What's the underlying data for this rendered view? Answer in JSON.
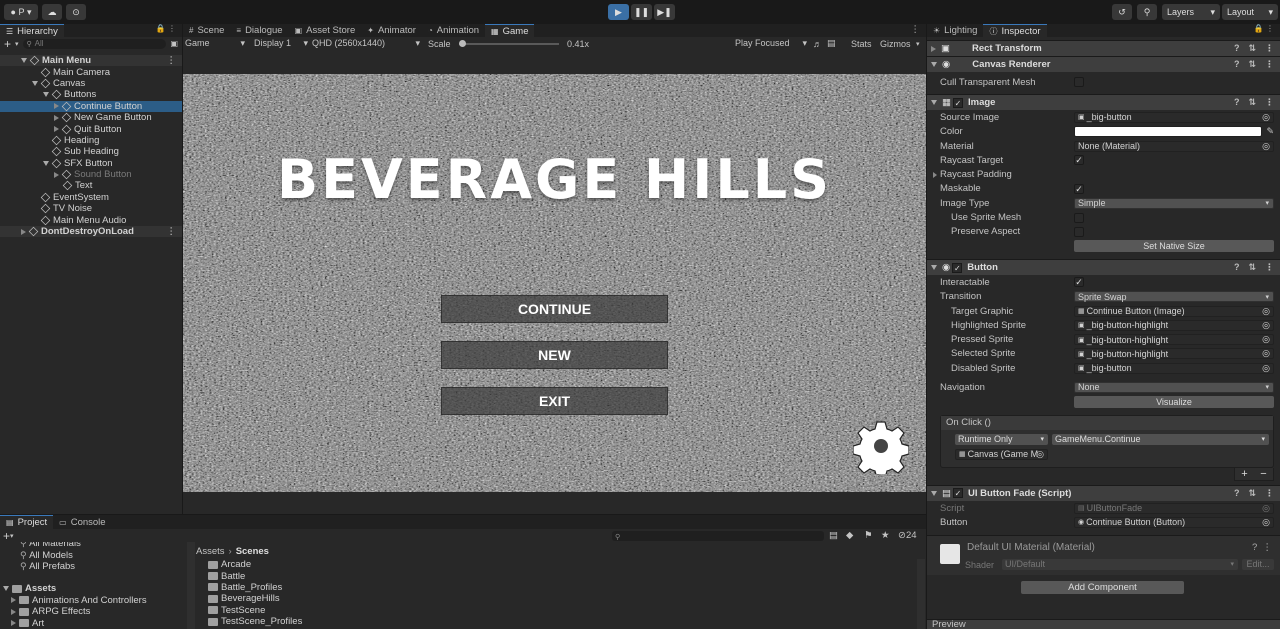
{
  "toolbar": {
    "account": "P",
    "layers": "Layers",
    "layout": "Layout"
  },
  "hierarchy": {
    "tab": "Hierarchy",
    "search_placeholder": "All",
    "items": [
      {
        "label": "Main Menu",
        "depth": 0,
        "kind": "scene",
        "expanded": true
      },
      {
        "label": "Main Camera",
        "depth": 1
      },
      {
        "label": "Canvas",
        "depth": 1,
        "expanded": true
      },
      {
        "label": "Buttons",
        "depth": 2,
        "expanded": true
      },
      {
        "label": "Continue Button",
        "depth": 3,
        "selected": true,
        "collapsed": true
      },
      {
        "label": "New Game Button",
        "depth": 3,
        "collapsed": true
      },
      {
        "label": "Quit Button",
        "depth": 3,
        "collapsed": true
      },
      {
        "label": "Heading",
        "depth": 2
      },
      {
        "label": "Sub Heading",
        "depth": 2
      },
      {
        "label": "SFX Button",
        "depth": 2,
        "expanded": true
      },
      {
        "label": "Sound Button",
        "depth": 3,
        "dim": true,
        "collapsed": true
      },
      {
        "label": "Text",
        "depth": 3
      },
      {
        "label": "EventSystem",
        "depth": 1
      },
      {
        "label": "TV Noise",
        "depth": 1
      },
      {
        "label": "Main Menu Audio",
        "depth": 1
      },
      {
        "label": "DontDestroyOnLoad",
        "depth": 0,
        "kind": "scene",
        "collapsed": true
      }
    ]
  },
  "center_tabs": [
    "Scene",
    "Dialogue",
    "Asset Store",
    "Animator",
    "Animation",
    "Game"
  ],
  "game_bar": {
    "mode": "Game",
    "display": "Display 1",
    "resolution": "QHD (2560x1440)",
    "scale_label": "Scale",
    "scale_value": "0.41x",
    "play_focused": "Play Focused",
    "stats": "Stats",
    "gizmos": "Gizmos"
  },
  "game": {
    "title": "BEVERAGE HILLS",
    "buttons": [
      "CONTINUE",
      "NEW",
      "EXIT"
    ]
  },
  "project": {
    "tabs": [
      "Project",
      "Console"
    ],
    "favorites": [
      "All Materials",
      "All Models",
      "All Prefabs"
    ],
    "assets_root": "Assets",
    "asset_folders": [
      "Animations And Controllers",
      "ARPG Effects",
      "Art"
    ],
    "breadcrumb": [
      "Assets",
      "Scenes"
    ],
    "scene_folders": [
      "Arcade",
      "Battle",
      "Battle_Profiles",
      "BeverageHills",
      "TestScene",
      "TestScene_Profiles"
    ],
    "count": "24"
  },
  "inspector": {
    "tabs": [
      "Lighting",
      "Inspector"
    ],
    "rect_transform": "Rect Transform",
    "canvas_renderer": {
      "title": "Canvas Renderer",
      "cull_label": "Cull Transparent Mesh"
    },
    "image": {
      "title": "Image",
      "source_image_label": "Source Image",
      "source_image": "_big-button",
      "color_label": "Color",
      "color": "#ffffff",
      "material_label": "Material",
      "material": "None (Material)",
      "raycast_target_label": "Raycast Target",
      "raycast_padding_label": "Raycast Padding",
      "maskable_label": "Maskable",
      "image_type_label": "Image Type",
      "image_type": "Simple",
      "use_sprite_mesh_label": "Use Sprite Mesh",
      "preserve_aspect_label": "Preserve Aspect",
      "set_native_size": "Set Native Size"
    },
    "button": {
      "title": "Button",
      "interactable_label": "Interactable",
      "transition_label": "Transition",
      "transition": "Sprite Swap",
      "target_graphic_label": "Target Graphic",
      "target_graphic": "Continue Button (Image)",
      "highlighted_label": "Highlighted Sprite",
      "highlighted": "_big-button-highlight",
      "pressed_label": "Pressed Sprite",
      "pressed": "_big-button-highlight",
      "selected_label": "Selected Sprite",
      "selected": "_big-button-highlight",
      "disabled_label": "Disabled Sprite",
      "disabled": "_big-button",
      "navigation_label": "Navigation",
      "navigation": "None",
      "visualize": "Visualize",
      "onclick_label": "On Click ()",
      "runtime": "Runtime Only",
      "function": "GameMenu.Continue",
      "target_obj": "Canvas (Game M"
    },
    "fade": {
      "title": "UI Button Fade (Script)",
      "script_label": "Script",
      "script": "UIButtonFade",
      "button_label": "Button",
      "button": "Continue Button (Button)"
    },
    "material": {
      "title": "Default UI Material (Material)",
      "shader_label": "Shader",
      "shader": "UI/Default",
      "edit": "Edit..."
    },
    "add_component": "Add Component",
    "preview": "Preview"
  }
}
